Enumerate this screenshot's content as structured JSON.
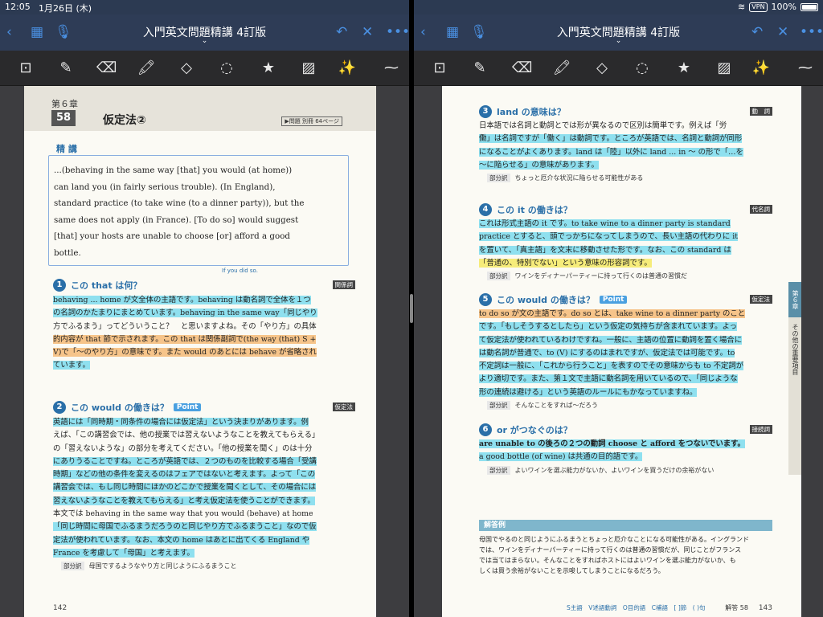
{
  "status": {
    "time": "12:05",
    "date": "1月26日 (木)",
    "vpn": "VPN",
    "battery": "100%"
  },
  "app": {
    "title": "入門英文問題精講 4訂版"
  },
  "left": {
    "chapter": "第６章",
    "number": "58",
    "section": "仮定法②",
    "ref": "▶問題 別冊 64ページ",
    "seikou": "精 講",
    "sentence_lines": [
      "...(behaving in the same way [that] you would (at home))",
      "can land you (in fairly serious trouble). (In England),",
      "standard practice (to take wine (to a dinner party)), but the",
      "same does not apply (in France). [To do so] would suggest",
      "[that] your hosts are unable to choose [or] afford a good",
      "bottle."
    ],
    "note_if_you_did": "If you did so.",
    "q1": {
      "num": "1",
      "head": "この that は何？",
      "tag": "関係詞",
      "lines": [
        "behaving ... home が文全体の主語です。behaving は動名詞で全体を１つ",
        "の名詞のかたまりにまとめています。behaving in the same way「同じやり",
        "方でふるまう」ってどういうこと？　と思いますよね。その「やり方」の具体",
        "的内容が that 節で示されます。この that は関係副詞で(the way (that) S +",
        "V)で「〜のやり方」の意味です。また would のあとには behave が省略され",
        "ています。"
      ]
    },
    "q2": {
      "num": "2",
      "head": "この would の働きは？",
      "point": "Point",
      "tag": "仮定法",
      "lines": [
        "英語には「同時期・同条件の場合には仮定法」という決まりがあります。例",
        "えば、「この講習会では、他の授業では習えないようなことを教えてもらえる」",
        "の「習えないような」の部分を考えてください。「他の授業を聞く」のは十分",
        "にありうることですね。ところが英語では、２つのものを比較する場合「受講",
        "時期」などの他の条件を変えるのはフェアではないと考えます。よって「この",
        "講習会では、もし同じ時間にほかのどこかで授業を聞くとして、その場合には",
        "習えないようなことを教えてもらえる」と考え仮定法を使うことができます。",
        "本文では behaving in the same way that you would (behave) at home",
        "「同じ時間に母国でふるまうだろうのと同じやり方でふるまうこと」なので仮",
        "定法が使われています。なお、本文の home はあとに出てくる England や",
        "France を考慮して「母国」と考えます。"
      ],
      "bubun_label": "部分訳",
      "bubun": "母国でするようなやり方と同じようにふるまうこと"
    },
    "page_no": "142"
  },
  "right": {
    "q3": {
      "num": "3",
      "head": "land の意味は？",
      "tag": "動　詞",
      "lines": [
        "日本語では名詞と動詞とでは形が異なるので区別は簡単です。例えば「労",
        "働」は名詞ですが「働く」は動詞です。ところが英語では、名詞と動詞が同形",
        "になることがよくあります。land は「陸」以外に land ... in 〜 の形で「…を",
        "〜に陥らせる」の意味があります。"
      ],
      "bubun_label": "部分訳",
      "bubun": "ちょっと厄介な状況に陥らせる可能性がある"
    },
    "q4": {
      "num": "4",
      "head": "この it の働きは？",
      "tag": "代名詞",
      "lines": [
        "これは形式主語の it です。to take wine to a dinner party is standard",
        "practice とすると、頭でっかちになってしまうので、長い主語の代わりに it",
        "を置いて、「真主語」を文末に移動させた形です。なお、この standard は",
        "「普通の、特別でない」という意味の形容詞です。"
      ],
      "bubun_label": "部分訳",
      "bubun": "ワインをディナーパーティーに持って行くのは普通の習慣だ"
    },
    "q5": {
      "num": "5",
      "head": "この would の働きは？",
      "point": "Point",
      "tag": "仮定法",
      "lines": [
        "to do so が文の主語です。do so とは、take wine to a dinner party のこと",
        "です。「もしそうするとしたら」という仮定の気持ちが含まれています。よっ",
        "て仮定法が使われているわけですね。一般に、主語の位置に動詞を置く場合に",
        "は動名詞が普通で、to (V) にするのはまれですが、仮定法では可能です。to",
        "不定詞は一般に、「これから行うこと」を表すのでその意味からも to 不定詞が",
        "より適切です。また、第１文で主語に動名詞を用いているので、「同じような",
        "形の連続は避ける」という英語のルールにもかなっていますね。"
      ],
      "bubun_label": "部分訳",
      "bubun": "そんなことをすれば〜だろう"
    },
    "q6": {
      "num": "6",
      "head": "or がつなぐのは？",
      "tag": "接続詞",
      "lines": [
        "are unable to の後ろの２つの動詞 choose と afford をつないでいます。",
        "a good bottle (of wine) は共通の目的語です。"
      ],
      "bubun_label": "部分訳",
      "bubun": "よいワインを選ぶ能力がないか、よいワインを買うだけの余裕がない"
    },
    "answer": {
      "head": "解答例",
      "lines": [
        "母国でやるのと同じようにふるまうとちょっと厄介なことになる可能性がある。イングランド",
        "では、ワインをディナーパーティーに持って行くのは普通の習慣だが、同じことがフランス",
        "では当てはまらない。そんなことをすればホストにはよいワインを選ぶ能力がないか、も",
        "しくは買う余裕がないことを示唆してしまうことになるだろう。"
      ]
    },
    "side_tab": {
      "chapter": "第６章",
      "label": "その他の重要項目"
    },
    "legend": "S主語　V述語動詞　O目的語　C補語　[ ]節　( )句",
    "answer_ref": "解答 58",
    "page_no": "143"
  }
}
